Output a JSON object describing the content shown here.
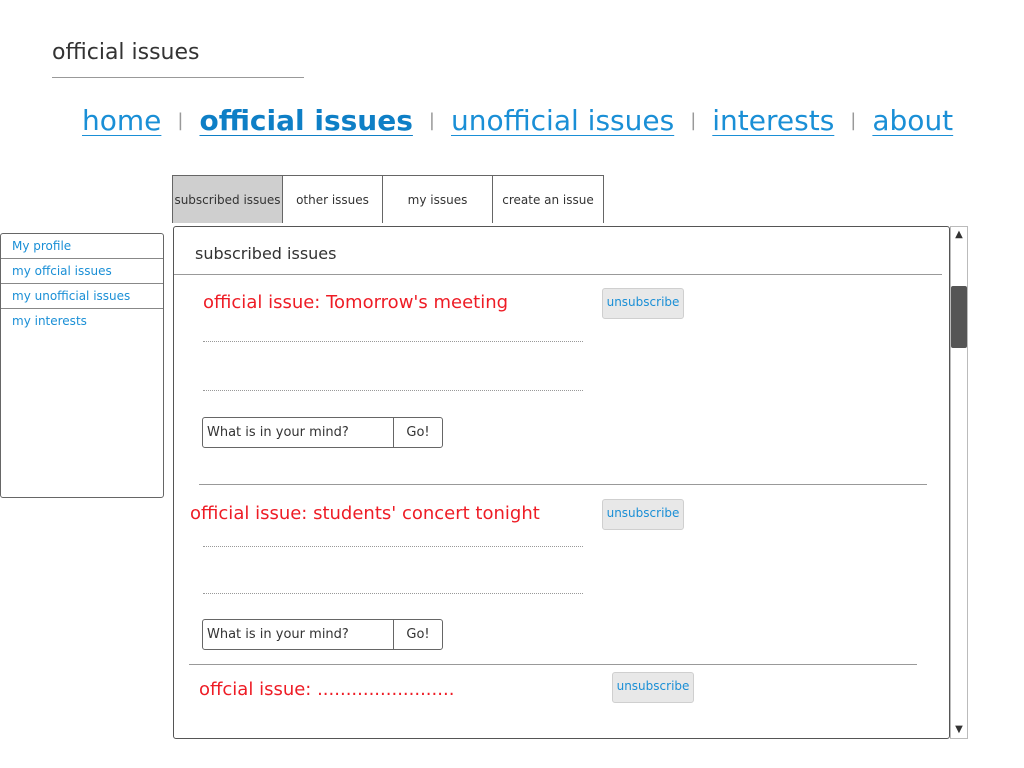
{
  "page": {
    "title": "official issues"
  },
  "nav": {
    "items": [
      {
        "label": "home"
      },
      {
        "label": "official issues",
        "active": true
      },
      {
        "label": "unofficial issues"
      },
      {
        "label": "interests"
      },
      {
        "label": "about"
      }
    ],
    "separator": "|"
  },
  "tabs": [
    {
      "label": "subscribed issues",
      "active": true
    },
    {
      "label": "other issues"
    },
    {
      "label": "my issues"
    },
    {
      "label": "create an issue"
    }
  ],
  "sidebar": {
    "items": [
      {
        "label": "My profile"
      },
      {
        "label": "my offcial issues"
      },
      {
        "label": "my unofficial issues"
      },
      {
        "label": "my interests"
      }
    ]
  },
  "panel": {
    "heading": "subscribed issues"
  },
  "issues": [
    {
      "title": "official issue: Tomorrow's meeting",
      "unsubscribe_label": "unsubscribe",
      "comment_placeholder": "What is in your mind?",
      "go_label": "Go!"
    },
    {
      "title": "official issue: students' concert tonight",
      "unsubscribe_label": "unsubscribe",
      "comment_placeholder": "What is in your mind?",
      "go_label": "Go!"
    },
    {
      "title": "offcial issue: ........................",
      "unsubscribe_label": "unsubscribe"
    }
  ],
  "scrollbar": {
    "up_icon": "▲",
    "down_icon": "▼"
  },
  "colors": {
    "link": "#1a8fd6",
    "issue_title": "#ee1c25",
    "active_tab": "#cfcfcf"
  }
}
